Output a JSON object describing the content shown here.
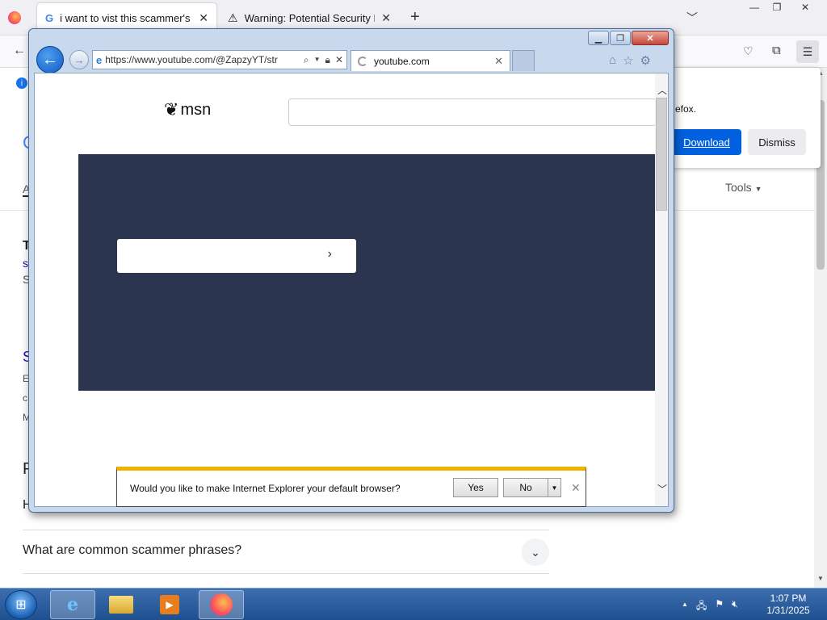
{
  "firefox": {
    "tabs": [
      {
        "title": "i want to vist this scammer's website",
        "active": true
      },
      {
        "title": "Warning: Potential Security Risk",
        "active": false
      }
    ],
    "new_tab": "+",
    "tab_list": "⌄",
    "popup": {
      "text_fragment": "efox.",
      "download": "Download",
      "dismiss": "Dismiss"
    },
    "google": {
      "tools": "Tools",
      "left_fragments": [
        "A",
        "T",
        "s",
        "S",
        "S",
        "E",
        "c",
        "M"
      ],
      "related_heading_fragment": "P",
      "questions": [
        "H",
        "What are common scammer phrases?"
      ]
    }
  },
  "ie": {
    "address": "https://www.youtube.com/@ZapzyYT/str",
    "tab_title": "youtube.com",
    "msn_logo_text": "msn",
    "notification": {
      "message": "Would you like to make Internet Explorer your default browser?",
      "yes": "Yes",
      "no": "No"
    }
  },
  "taskbar": {
    "time": "1:07 PM",
    "date": "1/31/2025"
  },
  "colors": {
    "ie_hero": "#2b3550",
    "notif_accent": "#f0b400",
    "firefox_primary": "#0060df"
  }
}
